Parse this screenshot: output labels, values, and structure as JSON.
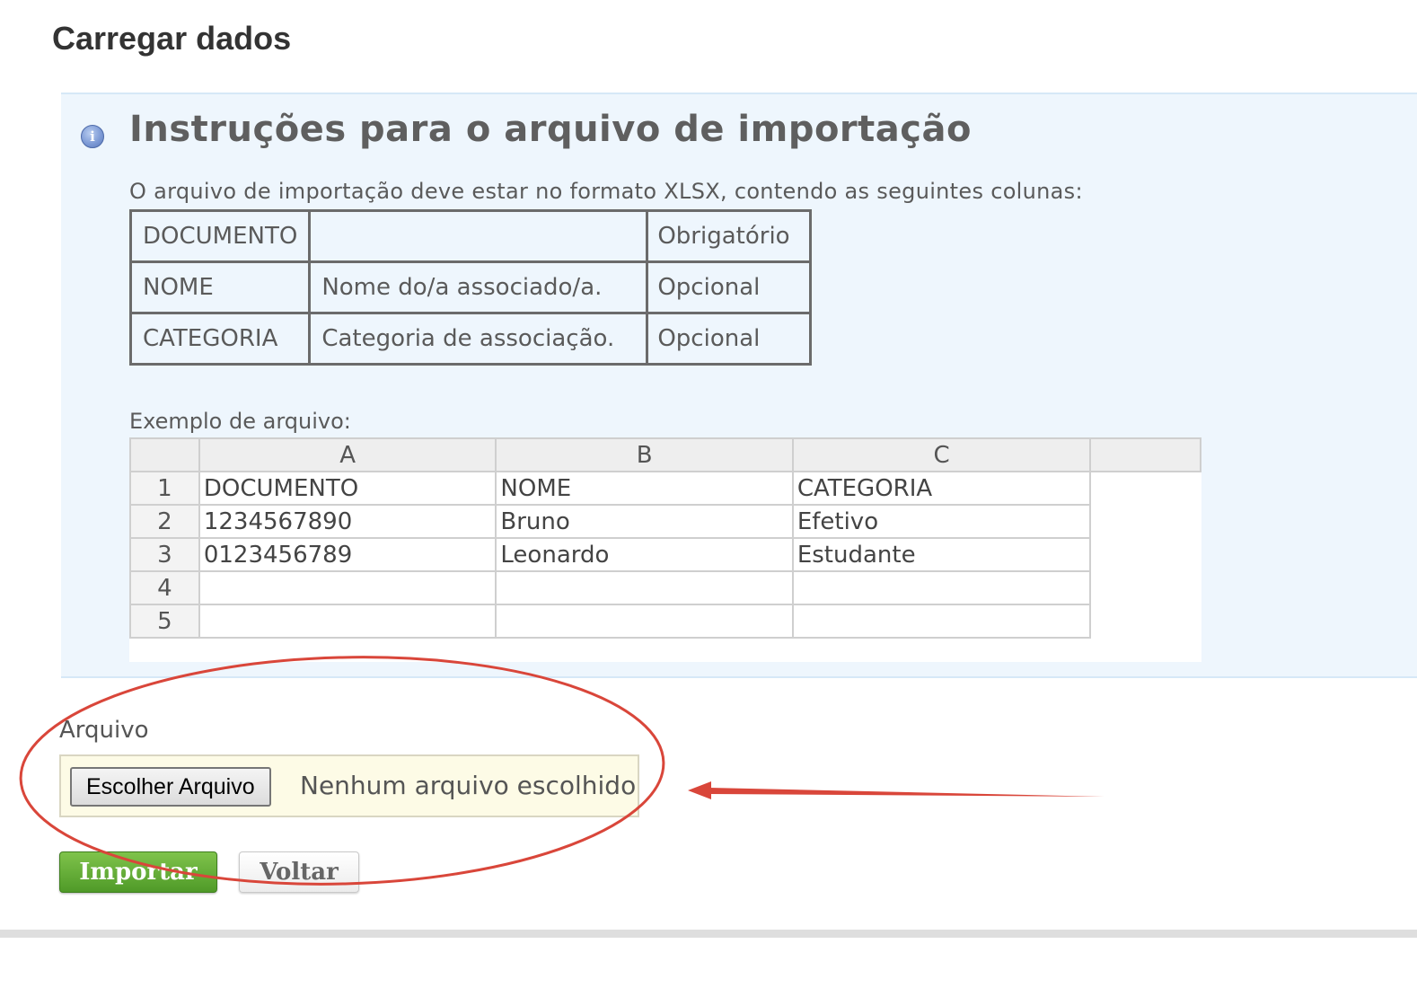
{
  "page": {
    "title": "Carregar dados"
  },
  "instructions": {
    "icon": "info-icon",
    "heading": "Instruções para o arquivo de importação",
    "text": "O arquivo de importação deve estar no formato XLSX, contendo as seguintes colunas:",
    "columns": [
      {
        "name": "DOCUMENTO",
        "description": "",
        "requirement": "Obrigatório"
      },
      {
        "name": "NOME",
        "description": "Nome do/a associado/a.",
        "requirement": "Opcional"
      },
      {
        "name": "CATEGORIA",
        "description": "Categoria de associação.",
        "requirement": "Opcional"
      }
    ],
    "example_label": "Exemplo de arquivo:",
    "example_sheet": {
      "col_headers": [
        "A",
        "B",
        "C"
      ],
      "rows": [
        {
          "num": "1",
          "cells": [
            "DOCUMENTO",
            "NOME",
            "CATEGORIA"
          ]
        },
        {
          "num": "2",
          "cells": [
            "1234567890",
            "Bruno",
            "Efetivo"
          ]
        },
        {
          "num": "3",
          "cells": [
            "0123456789",
            "Leonardo",
            "Estudante"
          ]
        },
        {
          "num": "4",
          "cells": [
            "",
            "",
            ""
          ]
        },
        {
          "num": "5",
          "cells": [
            "",
            "",
            ""
          ]
        }
      ]
    }
  },
  "upload": {
    "label": "Arquivo",
    "choose_button": "Escolher Arquivo",
    "status": "Nenhum arquivo escolhido"
  },
  "actions": {
    "import": "Importar",
    "back": "Voltar"
  },
  "colors": {
    "import_button": "#5aa832",
    "panel_background": "#eef6fd",
    "annotation": "#d9463a",
    "file_box": "#fdfbe6"
  }
}
